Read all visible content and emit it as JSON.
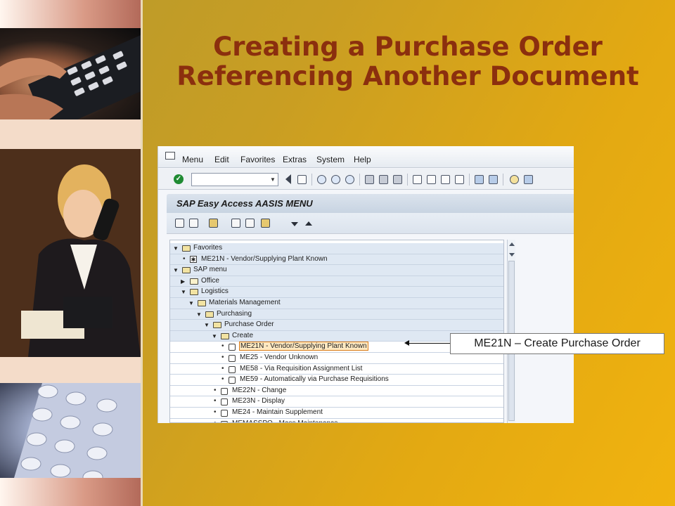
{
  "slide": {
    "title_line1": "Creating a Purchase Order",
    "title_line2": "Referencing Another Document",
    "callout": "ME21N – Create Purchase Order"
  },
  "sap": {
    "menus": [
      "Menu",
      "Edit",
      "Favorites",
      "Extras",
      "System",
      "Help"
    ],
    "screen_title": "SAP Easy Access  AASIS MENU",
    "command_field": {
      "value": "",
      "placeholder": ""
    },
    "toolbar_icons": [
      "enter-icon",
      "command-field",
      "back-icon",
      "save-icon",
      "back-nav-icon",
      "exit-icon",
      "cancel-icon",
      "print-icon",
      "find-icon",
      "find-next-icon",
      "first-page-icon",
      "previous-page-icon",
      "next-page-icon",
      "last-page-icon",
      "new-session-icon",
      "shortcut-icon",
      "help-icon",
      "layout-icon"
    ],
    "app_toolbar_icons": [
      "other-menu-icon",
      "create-role-icon",
      "assign-users-icon",
      "add-favorite-icon",
      "delete-favorite-icon",
      "change-favorite-icon",
      "move-down-icon",
      "move-up-icon"
    ],
    "tree": [
      {
        "label": "Favorites",
        "level": 0,
        "kind": "folder",
        "expander": "open"
      },
      {
        "label": "ME21N - Vendor/Supplying Plant Known",
        "level": 1,
        "kind": "fav"
      },
      {
        "label": "SAP menu",
        "level": 0,
        "kind": "folder",
        "expander": "open"
      },
      {
        "label": "Office",
        "level": 1,
        "kind": "folder",
        "expander": "closed"
      },
      {
        "label": "Logistics",
        "level": 1,
        "kind": "folder",
        "expander": "open"
      },
      {
        "label": "Materials Management",
        "level": 2,
        "kind": "folder",
        "expander": "open"
      },
      {
        "label": "Purchasing",
        "level": 3,
        "kind": "folder",
        "expander": "open"
      },
      {
        "label": "Purchase Order",
        "level": 4,
        "kind": "folder",
        "expander": "open"
      },
      {
        "label": "Create",
        "level": 5,
        "kind": "folder",
        "expander": "open"
      },
      {
        "label": "ME21N - Vendor/Supplying Plant Known",
        "level": 6,
        "kind": "tx",
        "highlight": true
      },
      {
        "label": "ME25 - Vendor Unknown",
        "level": 6,
        "kind": "tx"
      },
      {
        "label": "ME58 - Via Requisition Assignment List",
        "level": 6,
        "kind": "tx"
      },
      {
        "label": "ME59 - Automatically via Purchase Requisitions",
        "level": 6,
        "kind": "tx"
      },
      {
        "label": "ME22N - Change",
        "level": 5,
        "kind": "tx"
      },
      {
        "label": "ME23N - Display",
        "level": 5,
        "kind": "tx"
      },
      {
        "label": "ME24 - Maintain Supplement",
        "level": 5,
        "kind": "tx"
      },
      {
        "label": "MEMASSPO - Mass Maintenance",
        "level": 5,
        "kind": "tx"
      }
    ]
  }
}
